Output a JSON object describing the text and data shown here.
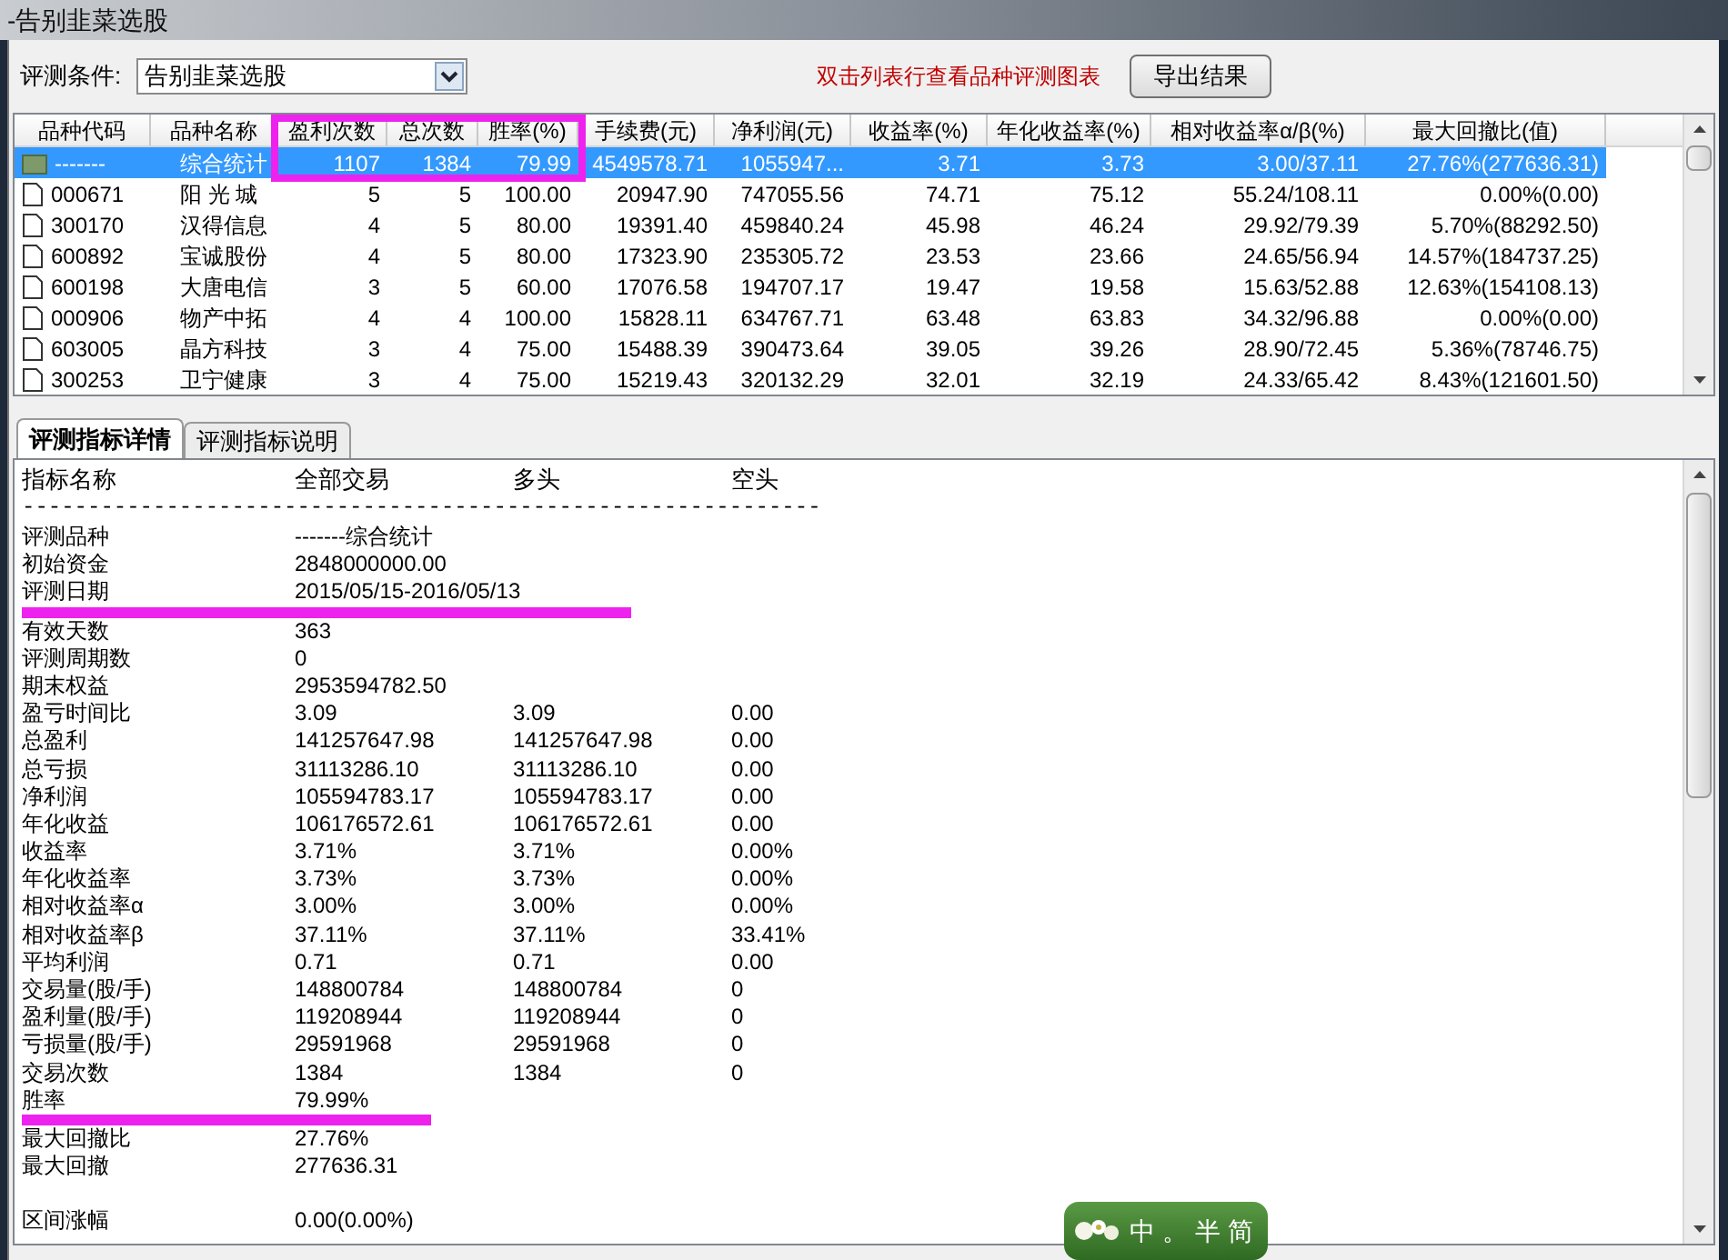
{
  "window": {
    "title": "-告别韭菜选股"
  },
  "toolbar": {
    "condition_label": "评测条件:",
    "condition_value": "告别韭菜选股",
    "hint": "双击列表行查看品种评测图表",
    "export_button": "导出结果"
  },
  "table": {
    "columns": [
      {
        "label": "品种代码"
      },
      {
        "label": "品种名称"
      },
      {
        "label": "盈利次数"
      },
      {
        "label": "总次数"
      },
      {
        "label": "胜率(%)"
      },
      {
        "label": "手续费(元)"
      },
      {
        "label": "净利润(元)"
      },
      {
        "label": "收益率(%)"
      },
      {
        "label": "年化收益率(%)"
      },
      {
        "label": "相对收益率α/β(%)"
      },
      {
        "label": "最大回撤比(值)"
      }
    ],
    "rows": [
      {
        "kind": "summary",
        "selected": true,
        "cells": [
          "-------",
          "综合统计",
          "1107",
          "1384",
          "79.99",
          "4549578.71",
          "1055947...",
          "3.71",
          "3.73",
          "3.00/37.11",
          "27.76%(277636.31)"
        ]
      },
      {
        "kind": "stock",
        "selected": false,
        "cells": [
          "000671",
          "阳 光 城",
          "5",
          "5",
          "100.00",
          "20947.90",
          "747055.56",
          "74.71",
          "75.12",
          "55.24/108.11",
          "0.00%(0.00)"
        ]
      },
      {
        "kind": "stock",
        "selected": false,
        "cells": [
          "300170",
          "汉得信息",
          "4",
          "5",
          "80.00",
          "19391.40",
          "459840.24",
          "45.98",
          "46.24",
          "29.92/79.39",
          "5.70%(88292.50)"
        ]
      },
      {
        "kind": "stock",
        "selected": false,
        "cells": [
          "600892",
          "宝诚股份",
          "4",
          "5",
          "80.00",
          "17323.90",
          "235305.72",
          "23.53",
          "23.66",
          "24.65/56.94",
          "14.57%(184737.25)"
        ]
      },
      {
        "kind": "stock",
        "selected": false,
        "cells": [
          "600198",
          "大唐电信",
          "3",
          "5",
          "60.00",
          "17076.58",
          "194707.17",
          "19.47",
          "19.58",
          "15.63/52.88",
          "12.63%(154108.13)"
        ]
      },
      {
        "kind": "stock",
        "selected": false,
        "cells": [
          "000906",
          "物产中拓",
          "4",
          "4",
          "100.00",
          "15828.11",
          "634767.71",
          "63.48",
          "63.83",
          "34.32/96.88",
          "0.00%(0.00)"
        ]
      },
      {
        "kind": "stock",
        "selected": false,
        "cells": [
          "603005",
          "晶方科技",
          "3",
          "4",
          "75.00",
          "15488.39",
          "390473.64",
          "39.05",
          "39.26",
          "28.90/72.45",
          "5.36%(78746.75)"
        ]
      },
      {
        "kind": "stock",
        "selected": false,
        "cells": [
          "300253",
          "卫宁健康",
          "3",
          "4",
          "75.00",
          "15219.43",
          "320132.29",
          "32.01",
          "32.19",
          "24.33/65.42",
          "8.43%(121601.50)"
        ]
      }
    ]
  },
  "tabs": [
    {
      "label": "评测指标详情",
      "selected": true
    },
    {
      "label": "评测指标说明",
      "selected": false
    }
  ],
  "detail": {
    "header": [
      "指标名称",
      "全部交易",
      "多头",
      "空头"
    ],
    "separator": "-------------------------------------------------------------",
    "rows": [
      {
        "kind": "metric",
        "cells": [
          "评测品种",
          "-------综合统计"
        ]
      },
      {
        "kind": "metric",
        "cells": [
          "初始资金",
          "2848000000.00"
        ]
      },
      {
        "kind": "metric",
        "cells": [
          "评测日期",
          "2015/05/15-2016/05/13"
        ]
      },
      {
        "kind": "highlight"
      },
      {
        "kind": "metric",
        "cells": [
          "有效天数",
          "363"
        ]
      },
      {
        "kind": "metric",
        "cells": [
          "评测周期数",
          "0"
        ]
      },
      {
        "kind": "metric",
        "cells": [
          "期末权益",
          "2953594782.50"
        ]
      },
      {
        "kind": "metric",
        "cells": [
          "盈亏时间比",
          "3.09",
          "3.09",
          "0.00"
        ]
      },
      {
        "kind": "metric",
        "cells": [
          "总盈利",
          "141257647.98",
          "141257647.98",
          "0.00"
        ]
      },
      {
        "kind": "metric",
        "cells": [
          "总亏损",
          "31113286.10",
          "31113286.10",
          "0.00"
        ]
      },
      {
        "kind": "metric",
        "cells": [
          "净利润",
          "105594783.17",
          "105594783.17",
          "0.00"
        ]
      },
      {
        "kind": "metric",
        "cells": [
          "年化收益",
          "106176572.61",
          "106176572.61",
          "0.00"
        ]
      },
      {
        "kind": "metric",
        "cells": [
          "收益率",
          "3.71%",
          "3.71%",
          "0.00%"
        ]
      },
      {
        "kind": "metric",
        "cells": [
          "年化收益率",
          "3.73%",
          "3.73%",
          "0.00%"
        ]
      },
      {
        "kind": "metric",
        "cells": [
          "相对收益率α",
          "3.00%",
          "3.00%",
          "0.00%"
        ]
      },
      {
        "kind": "metric",
        "cells": [
          "相对收益率β",
          "37.11%",
          "37.11%",
          "33.41%"
        ]
      },
      {
        "kind": "metric",
        "cells": [
          "平均利润",
          "0.71",
          "0.71",
          "0.00"
        ]
      },
      {
        "kind": "metric",
        "cells": [
          "交易量(股/手)",
          "148800784",
          "148800784",
          "0"
        ]
      },
      {
        "kind": "metric",
        "cells": [
          "盈利量(股/手)",
          "119208944",
          "119208944",
          "0"
        ]
      },
      {
        "kind": "metric",
        "cells": [
          "亏损量(股/手)",
          "29591968",
          "29591968",
          "0"
        ]
      },
      {
        "kind": "metric",
        "cells": [
          "交易次数",
          "1384",
          "1384",
          "0"
        ]
      },
      {
        "kind": "metric",
        "cells": [
          "胜率",
          "79.99%"
        ]
      },
      {
        "kind": "highlight"
      },
      {
        "kind": "metric",
        "cells": [
          "最大回撤比",
          "27.76%"
        ]
      },
      {
        "kind": "metric",
        "cells": [
          "最大回撤",
          "277636.31"
        ]
      },
      {
        "kind": "spacer"
      },
      {
        "kind": "metric",
        "cells": [
          "区间涨幅",
          "0.00(0.00%)"
        ]
      }
    ]
  },
  "ime_bar": {
    "items": [
      "中",
      "。",
      "半",
      "简"
    ]
  }
}
